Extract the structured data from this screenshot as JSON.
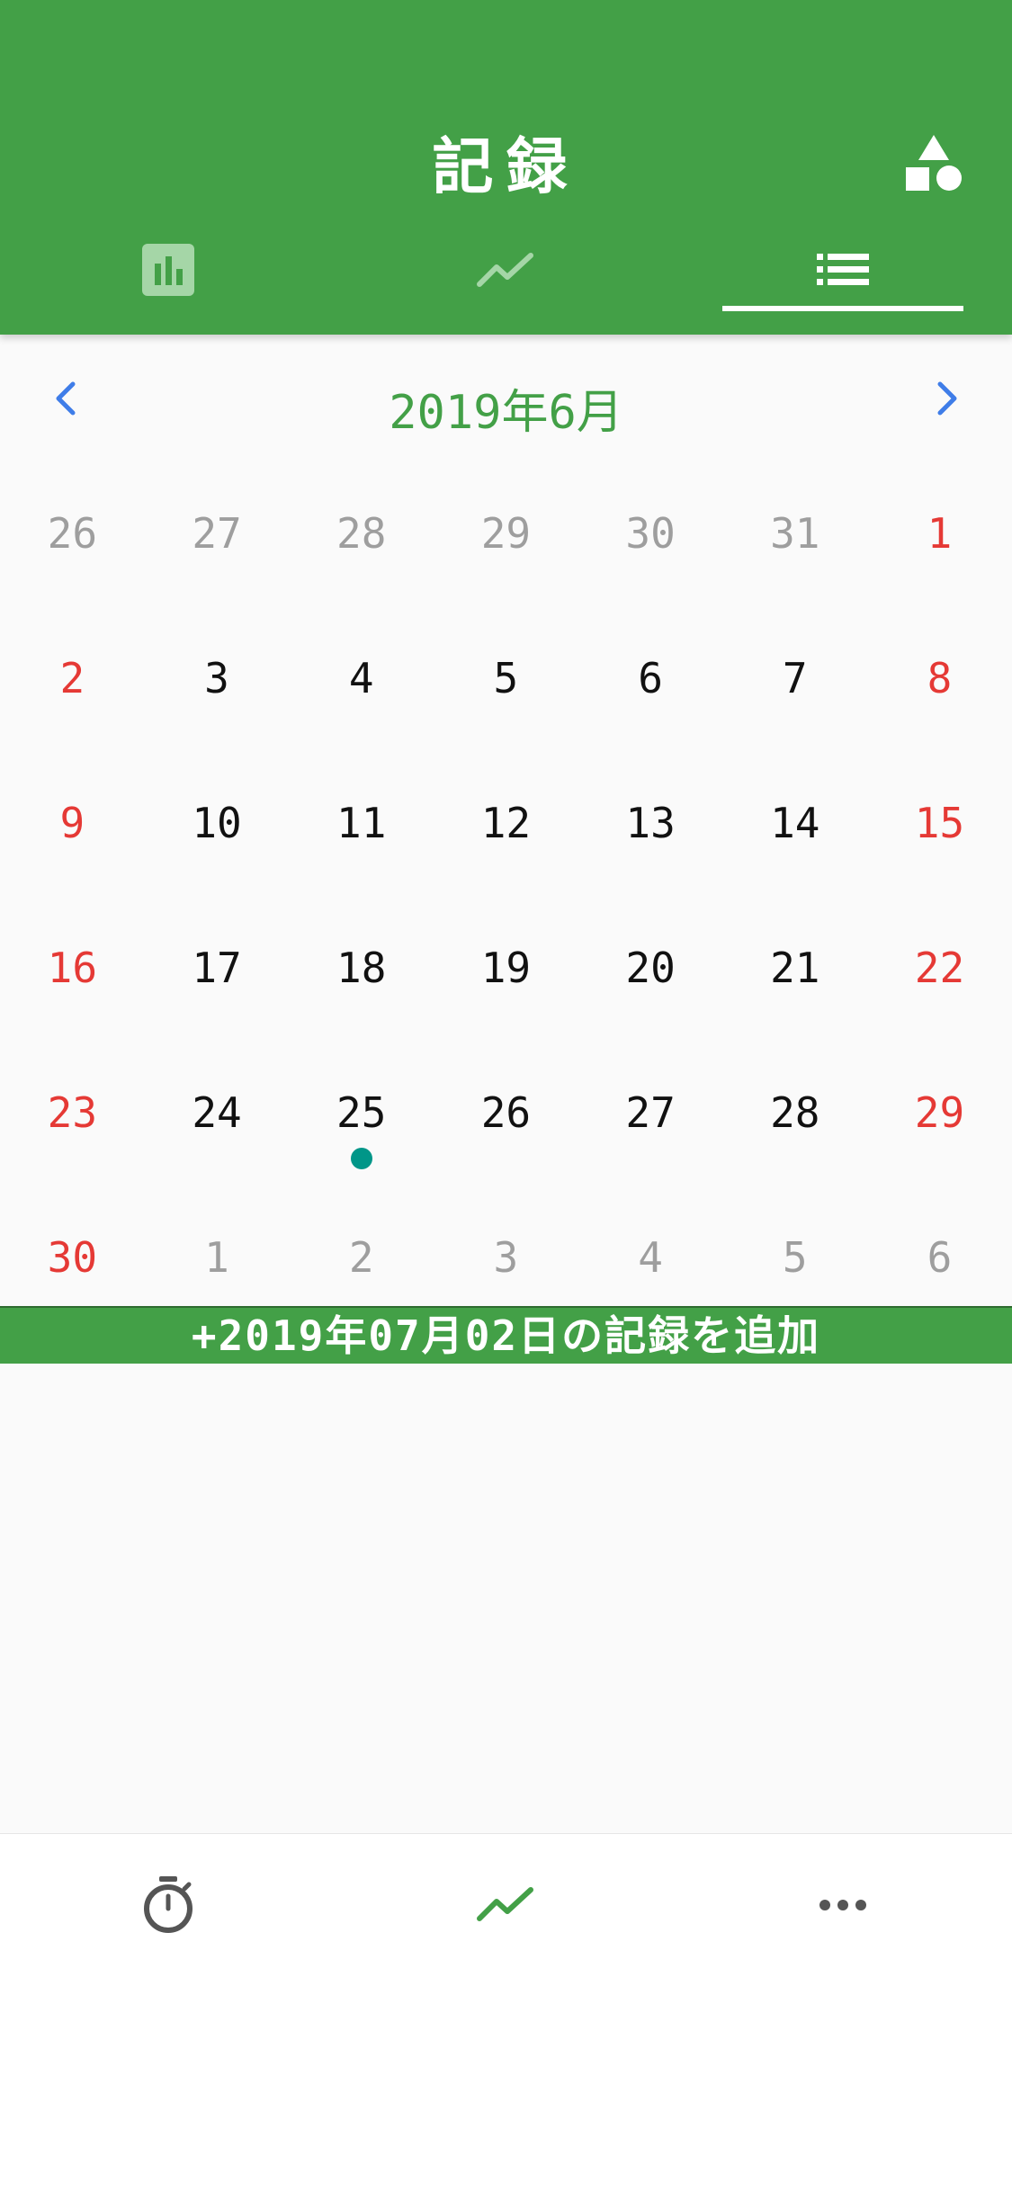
{
  "header": {
    "title": "記録",
    "colors": {
      "primary": "#43a047",
      "accent": "#ffffff"
    },
    "tabs": [
      {
        "icon": "bar-chart-icon",
        "active": false
      },
      {
        "icon": "trending-up-icon",
        "active": false
      },
      {
        "icon": "list-icon",
        "active": true
      }
    ],
    "action_icon": "shapes-icon"
  },
  "month_nav": {
    "title": "2019年6月",
    "prev_icon": "chevron-left-icon",
    "next_icon": "chevron-right-icon"
  },
  "calendar": {
    "weeks": [
      [
        {
          "d": "26",
          "t": "other"
        },
        {
          "d": "27",
          "t": "other"
        },
        {
          "d": "28",
          "t": "other"
        },
        {
          "d": "29",
          "t": "other"
        },
        {
          "d": "30",
          "t": "other"
        },
        {
          "d": "31",
          "t": "other"
        },
        {
          "d": "1",
          "t": "holiday"
        }
      ],
      [
        {
          "d": "2",
          "t": "holiday"
        },
        {
          "d": "3",
          "t": "normal"
        },
        {
          "d": "4",
          "t": "normal"
        },
        {
          "d": "5",
          "t": "normal"
        },
        {
          "d": "6",
          "t": "normal"
        },
        {
          "d": "7",
          "t": "normal"
        },
        {
          "d": "8",
          "t": "holiday"
        }
      ],
      [
        {
          "d": "9",
          "t": "holiday"
        },
        {
          "d": "10",
          "t": "normal"
        },
        {
          "d": "11",
          "t": "normal"
        },
        {
          "d": "12",
          "t": "normal"
        },
        {
          "d": "13",
          "t": "normal"
        },
        {
          "d": "14",
          "t": "normal"
        },
        {
          "d": "15",
          "t": "holiday"
        }
      ],
      [
        {
          "d": "16",
          "t": "holiday"
        },
        {
          "d": "17",
          "t": "normal"
        },
        {
          "d": "18",
          "t": "normal"
        },
        {
          "d": "19",
          "t": "normal"
        },
        {
          "d": "20",
          "t": "normal"
        },
        {
          "d": "21",
          "t": "normal"
        },
        {
          "d": "22",
          "t": "holiday"
        }
      ],
      [
        {
          "d": "23",
          "t": "holiday"
        },
        {
          "d": "24",
          "t": "normal"
        },
        {
          "d": "25",
          "t": "normal",
          "marker": true
        },
        {
          "d": "26",
          "t": "normal"
        },
        {
          "d": "27",
          "t": "normal"
        },
        {
          "d": "28",
          "t": "normal"
        },
        {
          "d": "29",
          "t": "holiday"
        }
      ],
      [
        {
          "d": "30",
          "t": "holiday"
        },
        {
          "d": "1",
          "t": "other"
        },
        {
          "d": "2",
          "t": "other"
        },
        {
          "d": "3",
          "t": "other"
        },
        {
          "d": "4",
          "t": "other"
        },
        {
          "d": "5",
          "t": "other"
        },
        {
          "d": "6",
          "t": "other"
        }
      ]
    ],
    "colors": {
      "holiday": "#e53935",
      "other": "#9e9e9e",
      "normal": "#111111",
      "marker": "#009688"
    }
  },
  "add_record": {
    "label": "+2019年07月02日の記録を追加"
  },
  "bottom_nav": [
    {
      "icon": "stopwatch-icon",
      "active": false
    },
    {
      "icon": "trending-up-icon",
      "active": true
    },
    {
      "icon": "more-horizontal-icon",
      "active": false
    }
  ]
}
